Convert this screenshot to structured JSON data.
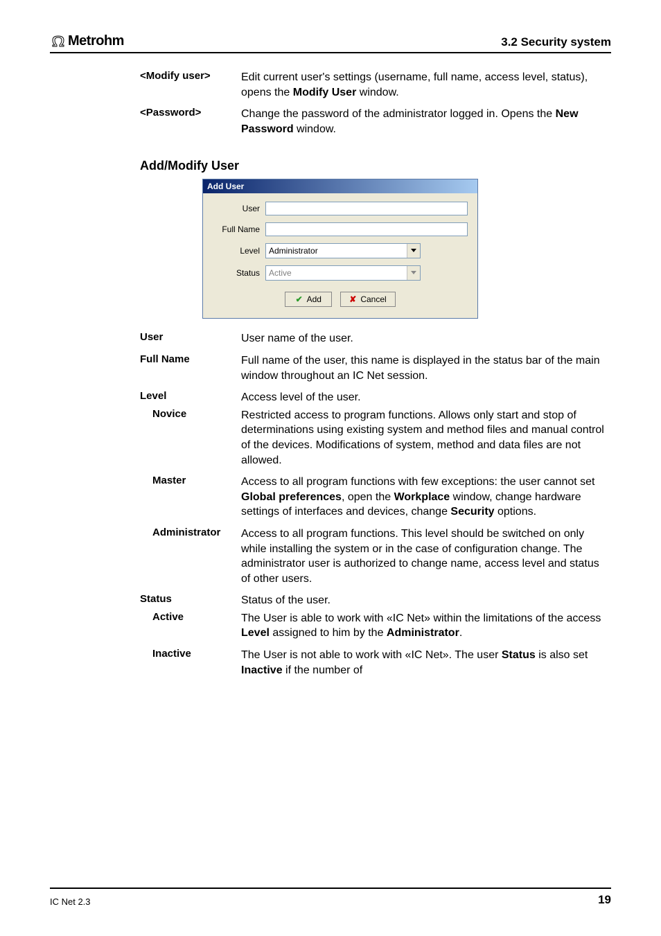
{
  "header": {
    "brand": "Metrohm",
    "section": "3.2  Security system"
  },
  "top_options": {
    "modify_user": {
      "term": "<Modify user>",
      "desc_pre": "Edit current user's settings (username, full name, access level, status), opens the ",
      "bold": "Modify User",
      "desc_post": " window."
    },
    "password": {
      "term": "<Password>",
      "desc_pre": "Change the password of the administrator logged in. Opens the ",
      "bold": "New Password",
      "desc_post": " window."
    }
  },
  "subhead": "Add/Modify User",
  "dialog": {
    "title": "Add User",
    "labels": {
      "user": "User",
      "full_name": "Full Name",
      "level": "Level",
      "status": "Status"
    },
    "values": {
      "user": "",
      "full_name": "",
      "level": "Administrator",
      "status": "Active"
    },
    "buttons": {
      "add": "Add",
      "cancel": "Cancel"
    }
  },
  "definitions": {
    "user": {
      "term": "User",
      "desc": "User name of the user."
    },
    "full_name": {
      "term": "Full Name",
      "desc": "Full name of the user, this name is displayed in the status bar of the main window throughout an IC Net session."
    },
    "level": {
      "term": "Level",
      "desc": "Access level of the user."
    },
    "novice": {
      "term": "Novice",
      "desc": "Restricted access to program functions. Allows only start and stop of determinations using existing system and method files and manual control of the devices. Modifications of system, method and data files are not allowed."
    },
    "master": {
      "term": "Master",
      "p1": "Access to all program functions with few exceptions: the user cannot set ",
      "b1": "Global preferences",
      "p2": ", open the ",
      "b2": "Workplace",
      "p3": " window, change hardware settings of interfaces and devices, change ",
      "b3": "Security",
      "p4": " options."
    },
    "administrator": {
      "term": "Administrator",
      "desc": "Access to all program functions. This level should be switched on only while installing the system or in the case of configuration change. The administrator user is authorized to change name, access level and status of other users."
    },
    "status": {
      "term": "Status",
      "desc": "Status of the user."
    },
    "active": {
      "term": "Active",
      "p1": "The User is able to work with «IC Net» within the limitations of the access ",
      "b1": "Level",
      "p2": " assigned to him by the ",
      "b2": "Administrator",
      "p3": "."
    },
    "inactive": {
      "term": "Inactive",
      "p1": "The User is not able to work with «IC Net». The user ",
      "b1": "Status",
      "p2": " is also set ",
      "b2": "Inactive",
      "p3": " if the number of"
    }
  },
  "footer": {
    "left": "IC Net 2.3",
    "right": "19"
  }
}
